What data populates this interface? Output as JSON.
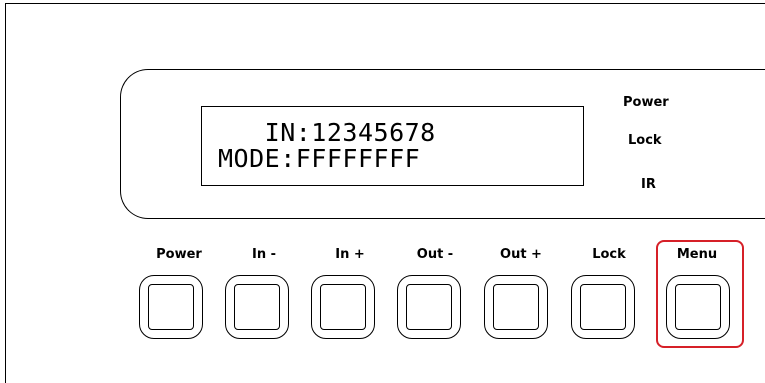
{
  "lcd": {
    "line1": "   IN:12345678",
    "line2": "MODE:FFFFFFFF"
  },
  "indicators": {
    "power": "Power",
    "lock": "Lock",
    "ir": "IR"
  },
  "buttons": [
    {
      "label": "Power"
    },
    {
      "label": "In -"
    },
    {
      "label": "In +"
    },
    {
      "label": "Out -"
    },
    {
      "label": "Out +"
    },
    {
      "label": "Lock"
    },
    {
      "label": "Menu"
    }
  ],
  "highlighted_button": "Menu",
  "colors": {
    "highlight": "#d62028",
    "lines": "#000000"
  }
}
